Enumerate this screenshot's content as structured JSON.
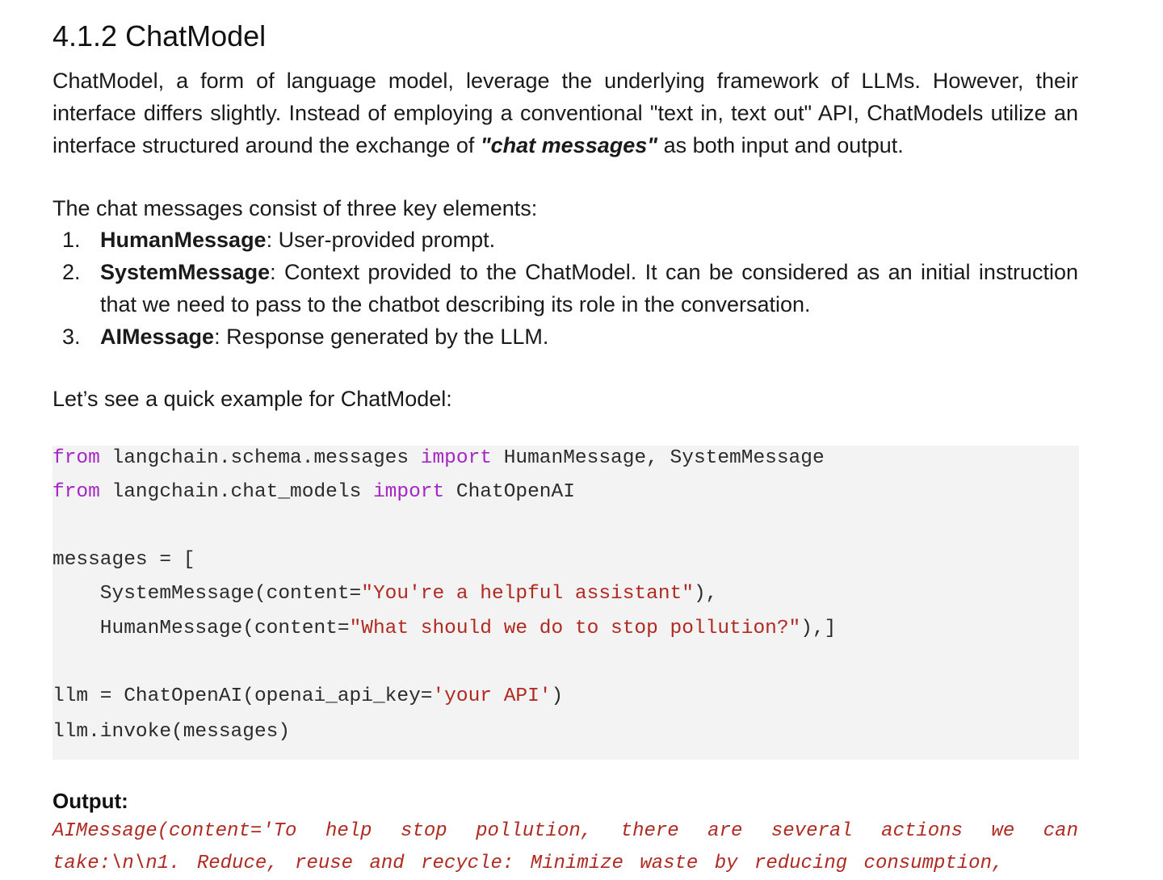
{
  "section": {
    "heading": "4.1.2 ChatModel"
  },
  "intro": {
    "text_before_emphasis": "ChatModel, a form of language model, leverage the underlying framework of LLMs. However, their interface differs slightly. Instead of employing a conventional \"text in, text out\" API, ChatModels utilize an interface structured around the exchange of ",
    "emphasis": "\"chat messages\"",
    "text_after_emphasis": " as both input and output."
  },
  "elements_intro": "The chat messages consist of three key elements:",
  "elements": [
    {
      "num": "1.",
      "term": "HumanMessage",
      "desc": ": User-provided prompt."
    },
    {
      "num": "2.",
      "term": "SystemMessage",
      "desc": ":  Context provided to the ChatModel. It can be considered as an initial instruction that we need to pass to the chatbot describing its role in the conversation."
    },
    {
      "num": "3.",
      "term": "AIMessage",
      "desc": ": Response generated by the LLM."
    }
  ],
  "example_intro": "Let’s see a quick example for ChatModel:",
  "code": {
    "l1": {
      "kw1": "from",
      "mod1": " langchain.schema.messages ",
      "kw2": "import",
      "names": " HumanMessage, SystemMessage"
    },
    "l2": {
      "kw1": "from",
      "mod1": " langchain.chat_models ",
      "kw2": "import",
      "names": " ChatOpenAI"
    },
    "l3": "messages = [",
    "l4": {
      "pre": "    SystemMessage(content=",
      "str": "\"You're a helpful assistant\"",
      "post": "),"
    },
    "l5": {
      "pre": "    HumanMessage(content=",
      "str": "\"What should we do to stop pollution?\"",
      "post": "),]"
    },
    "l6": {
      "pre": "llm = ChatOpenAI(openai_api_key=",
      "str": "'your API'",
      "post": ")"
    },
    "l7": "llm.invoke(messages)"
  },
  "output": {
    "label": "Output:",
    "text": "AIMessage(content='To help stop pollution, there are several actions we can take:\\n\\n1. Reduce, reuse and  recycle: Minimize waste by reducing consumption,"
  },
  "colors": {
    "keyword": "#a626c5",
    "string": "#b02a22",
    "code_background": "#f3f3f3"
  }
}
